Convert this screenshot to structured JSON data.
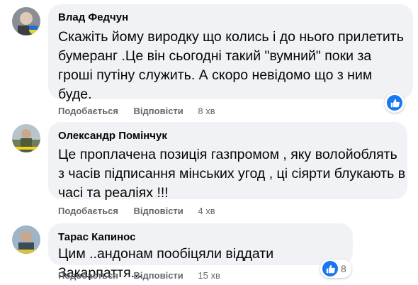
{
  "comments": [
    {
      "author": "Влад Федчун",
      "text": "Скажіть йому виродку що колись і до нього прилетить\nбумеранг .Це він сьогодні такий \"вумний\" поки за\nгроші путіну служить. А скоро невідомо що з ним\nбуде.",
      "like_label": "Подобається",
      "reply_label": "Відповісти",
      "time": "8 хв",
      "reaction_icon": "like-icon",
      "reaction_count": ""
    },
    {
      "author": "Олександр Помінчук",
      "text": "Це проплачена позиція газпромом , яку волойоблять\nз часів підписання мінських угод , ці сіярти блукають в\nчасі та реаліях !!!",
      "like_label": "Подобається",
      "reply_label": "Відповісти",
      "time": "4 хв"
    },
    {
      "author": "Тарас Капинос",
      "text": "Цим ..андонам пообіцяли віддати Закарпаття...",
      "like_label": "Подобається",
      "reply_label": "Відповісти",
      "time": "15 хв",
      "reaction_icon": "like-icon",
      "reaction_count": "8"
    }
  ],
  "colors": {
    "bubble": "#f0f2f5",
    "secondary_text": "#65676b",
    "like_blue": "#1877f2"
  }
}
